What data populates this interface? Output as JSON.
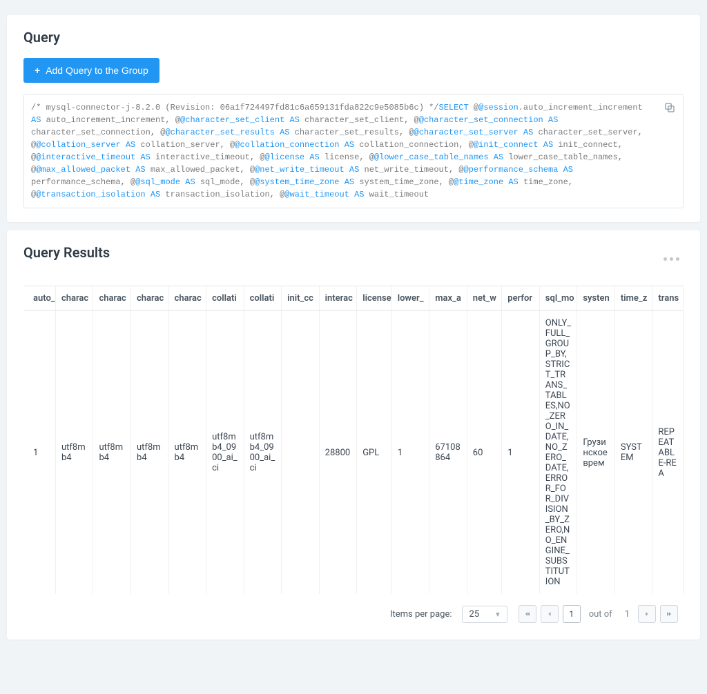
{
  "query_card": {
    "title": "Query",
    "add_button": "Add Query to the Group",
    "sql_tokens": [
      {
        "t": "/* mysql-connector-j-8.2.0 (Revision: 06a1f724497fd81c6a659131fda822c9e5085b6c) */",
        "k": false
      },
      {
        "t": "SELECT",
        "k": true
      },
      {
        "t": "  @",
        "k": false
      },
      {
        "t": "@session",
        "k": true
      },
      {
        "t": ".auto_increment_increment ",
        "k": false
      },
      {
        "t": "AS",
        "k": true
      },
      {
        "t": " auto_increment_increment, @",
        "k": false
      },
      {
        "t": "@character_set_client AS",
        "k": true
      },
      {
        "t": " character_set_client, @",
        "k": false
      },
      {
        "t": "@character_set_connection AS",
        "k": true
      },
      {
        "t": " character_set_connection, @",
        "k": false
      },
      {
        "t": "@character_set_results AS",
        "k": true
      },
      {
        "t": " character_set_results, @",
        "k": false
      },
      {
        "t": "@character_set_server AS",
        "k": true
      },
      {
        "t": " character_set_server, @",
        "k": false
      },
      {
        "t": "@collation_server AS",
        "k": true
      },
      {
        "t": " collation_server, @",
        "k": false
      },
      {
        "t": "@collation_connection AS",
        "k": true
      },
      {
        "t": " collation_connection, @",
        "k": false
      },
      {
        "t": "@init_connect AS",
        "k": true
      },
      {
        "t": " init_connect, @",
        "k": false
      },
      {
        "t": "@interactive_timeout AS",
        "k": true
      },
      {
        "t": " interactive_timeout, @",
        "k": false
      },
      {
        "t": "@license AS",
        "k": true
      },
      {
        "t": " license, @",
        "k": false
      },
      {
        "t": "@lower_case_table_names AS",
        "k": true
      },
      {
        "t": " lower_case_table_names, @",
        "k": false
      },
      {
        "t": "@max_allowed_packet AS",
        "k": true
      },
      {
        "t": " max_allowed_packet, @",
        "k": false
      },
      {
        "t": "@net_write_timeout AS",
        "k": true
      },
      {
        "t": " net_write_timeout, @",
        "k": false
      },
      {
        "t": "@performance_schema AS",
        "k": true
      },
      {
        "t": " performance_schema, @",
        "k": false
      },
      {
        "t": "@sql_mode AS",
        "k": true
      },
      {
        "t": " sql_mode, @",
        "k": false
      },
      {
        "t": "@system_time_zone AS",
        "k": true
      },
      {
        "t": " system_time_zone, @",
        "k": false
      },
      {
        "t": "@time_zone AS",
        "k": true
      },
      {
        "t": " time_zone, @",
        "k": false
      },
      {
        "t": "@transaction_isolation AS",
        "k": true
      },
      {
        "t": " transaction_isolation, @",
        "k": false
      },
      {
        "t": "@wait_timeout AS",
        "k": true
      },
      {
        "t": " wait_timeout",
        "k": false
      }
    ]
  },
  "results_card": {
    "title": "Query Results",
    "columns": [
      "auto_",
      "charac",
      "charac",
      "charac",
      "charac",
      "collati",
      "collati",
      "init_cc",
      "interac",
      "license",
      "lower_",
      "max_a",
      "net_w",
      "perfor",
      "sql_mo",
      "systen",
      "time_z",
      "trans"
    ],
    "row": [
      "1",
      "utf8mb4",
      "utf8mb4",
      "utf8mb4",
      "utf8mb4",
      "utf8mb4_0900_ai_ci",
      "utf8mb4_0900_ai_ci",
      "",
      "28800",
      "GPL",
      "1",
      "67108864",
      "60",
      "1",
      "ONLY_FULL_GROUP_BY,STRICT_TRANS_TABLES,NO_ZERO_IN_DATE,NO_ZERO_DATE,ERROR_FOR_DIVISION_BY_ZERO,NO_ENGINE_SUBSTITUTION",
      "Грузинское врем",
      "SYSTEM",
      "REPEATABLE-REA"
    ],
    "pager": {
      "items_per_page_label": "Items per page:",
      "items_per_page_value": "25",
      "current_page": "1",
      "out_of_label": "out of",
      "total_pages": "1"
    }
  }
}
